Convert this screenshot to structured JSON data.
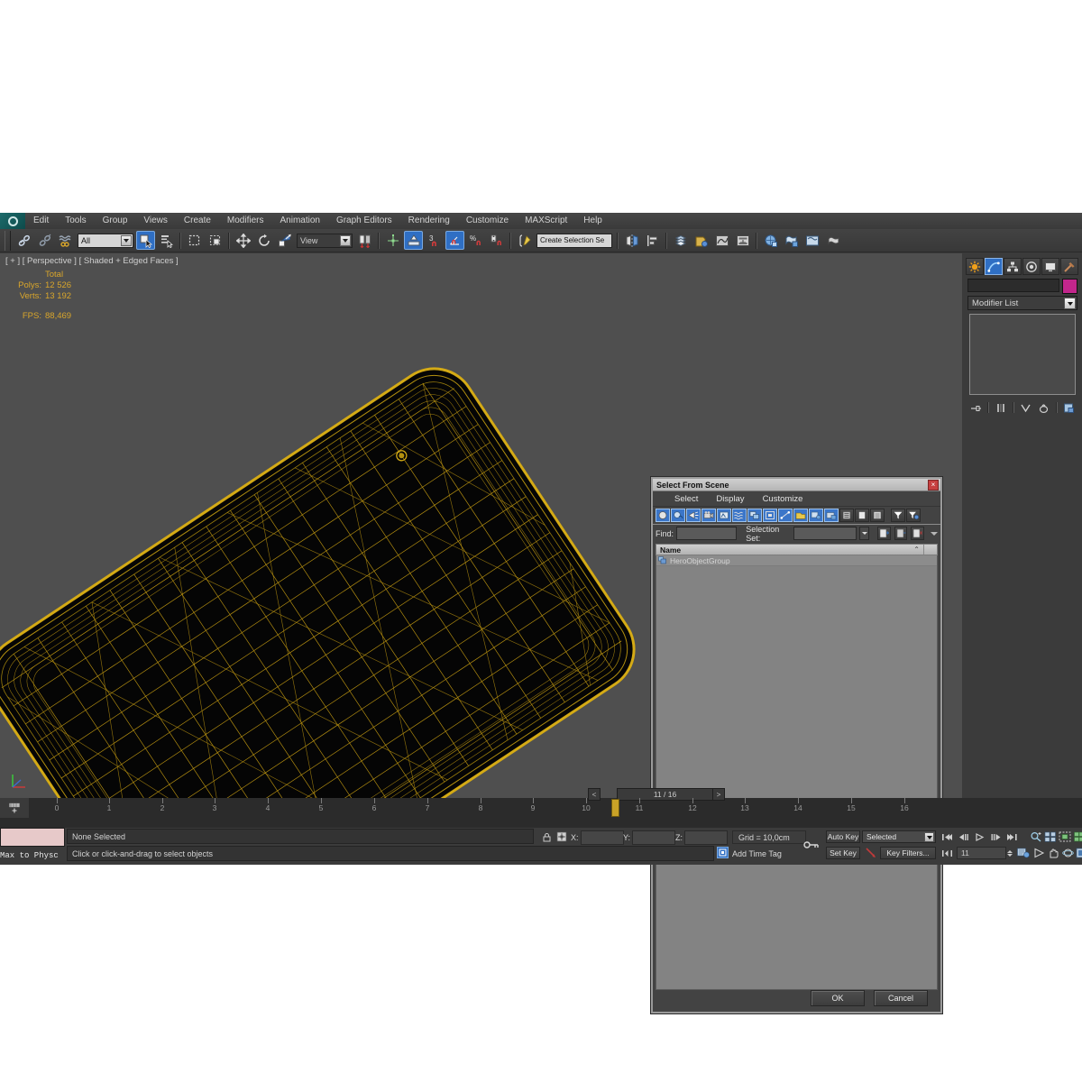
{
  "app": {
    "name": "3ds Max",
    "logo_icon": "max-logo-icon"
  },
  "menu": {
    "items": [
      "Edit",
      "Tools",
      "Group",
      "Views",
      "Create",
      "Modifiers",
      "Animation",
      "Graph Editors",
      "Rendering",
      "Customize",
      "MAXScript",
      "Help"
    ]
  },
  "toolbar": {
    "selection_filter": "All",
    "reference_coordinate_system": "View",
    "named_selection_set": "Create Selection Se",
    "angle_snap_value": "3",
    "icons": [
      "undo-icon",
      "redo-icon",
      "select-link-icon",
      "unlink-icon",
      "bind-space-warp-icon",
      "select-object-icon",
      "select-by-name-icon",
      "rectangular-selection-region-icon",
      "window-crossing-icon",
      "select-and-move-icon",
      "select-and-rotate-icon",
      "select-and-scale-icon",
      "use-pivot-point-center-icon",
      "select-and-manipulate-icon",
      "snaps-toggle-icon",
      "angle-snap-toggle-icon",
      "percent-snap-toggle-icon",
      "spinner-snap-toggle-icon",
      "edit-named-selection-sets-icon",
      "mirror-icon",
      "align-icon",
      "layer-manager-icon",
      "graphite-modeling-tools-icon",
      "curve-editor-icon",
      "schematic-view-icon",
      "material-editor-icon",
      "render-setup-icon",
      "rendered-frame-window-icon",
      "render-production-icon"
    ]
  },
  "viewport": {
    "label": "[ + ] [ Perspective ] [ Shaded + Edged Faces ]",
    "stats": {
      "column_header": "Total",
      "rows": [
        {
          "label": "Polys:",
          "value": "12 526"
        },
        {
          "label": "Verts:",
          "value": "13 192"
        }
      ],
      "fps_label": "FPS:",
      "fps_value": "88,469"
    },
    "object_wireframe_color": "#d4aa15",
    "background_color": "#4f4f4f",
    "axis_tripod": "axis-tripod-icon"
  },
  "command_panel": {
    "tabs": [
      {
        "name": "create-tab",
        "icon": "create-star-icon",
        "active": false
      },
      {
        "name": "modify-tab",
        "icon": "modify-curve-icon",
        "active": true
      },
      {
        "name": "hierarchy-tab",
        "icon": "hierarchy-icon",
        "active": false
      },
      {
        "name": "motion-tab",
        "icon": "motion-wheel-icon",
        "active": false
      },
      {
        "name": "display-tab",
        "icon": "display-monitor-icon",
        "active": false
      },
      {
        "name": "utilities-tab",
        "icon": "utilities-hammer-icon",
        "active": false
      }
    ],
    "object_name_value": "",
    "object_color": "#c2268c",
    "modifier_list_label": "Modifier List",
    "stack_buttons": [
      "pin-stack-icon",
      "show-end-result-icon",
      "make-unique-icon",
      "remove-modifier-icon",
      "configure-modifier-sets-icon"
    ]
  },
  "dialog": {
    "title": "Select From Scene",
    "close_icon": "close-icon",
    "menu": [
      "Select",
      "Display",
      "Customize"
    ],
    "tool_icons": [
      "display-geometry-icon",
      "display-shapes-icon",
      "display-lights-icon",
      "display-cameras-icon",
      "display-helpers-icon",
      "display-space-warps-icon",
      "display-groups-icon",
      "display-xrefs-icon",
      "display-bones-icon",
      "display-containers-icon",
      "display-all-icon",
      "display-none-icon",
      "display-invert-icon",
      "display-children-icon",
      "display-influences-icon",
      "expand-all-icon",
      "filter-icon",
      "advanced-filter-icon"
    ],
    "find_label": "Find:",
    "find_value": "",
    "selection_set_label": "Selection Set:",
    "selection_set_value": "",
    "list_header": "Name",
    "sort_indicator": "sort-ascending-icon",
    "rows": [
      {
        "icon": "group-icon",
        "name": "HeroObjectGroup"
      }
    ],
    "ok_label": "OK",
    "cancel_label": "Cancel"
  },
  "timeline": {
    "frame_indicator": "11 / 16",
    "prev_arrow": "<",
    "next_arrow": ">",
    "current_frame": 11,
    "ticks": [
      "0",
      "1",
      "2",
      "3",
      "4",
      "5",
      "6",
      "7",
      "8",
      "9",
      "10",
      "11",
      "12",
      "13",
      "14",
      "15",
      "16"
    ],
    "open_minicurve_icon": "open-mini-curve-editor-icon"
  },
  "status_bar": {
    "max_to_physical_label": "Max to Physc",
    "selection_status": "None Selected",
    "prompt": "Click or click-and-drag to select objects",
    "lock_icon": "selection-lock-icon",
    "absolute_mode_icon": "absolute-relative-transform-icon",
    "coords": [
      {
        "label": "X:",
        "value": ""
      },
      {
        "label": "Y:",
        "value": ""
      },
      {
        "label": "Z:",
        "value": ""
      }
    ],
    "grid_label": "Grid = 10,0cm",
    "add_time_tag_label": "Add Time Tag",
    "add_time_tag_icon": "time-tag-icon",
    "key_mode_icon": "key-mode-toggle-icon"
  },
  "animation_controls": {
    "auto_key_label": "Auto Key",
    "set_key_label": "Set Key",
    "filter_value": "Selected",
    "key_filters_label": "Key Filters...",
    "set_key_arrow_icon": "set-key-arrow-icon",
    "frame_field_value": "11",
    "playback_icons": [
      "go-to-start-icon",
      "previous-frame-icon",
      "play-animation-icon",
      "next-frame-icon",
      "go-to-end-icon",
      "key-mode-toggle-icon"
    ],
    "viewport_nav_icons": [
      "zoom-icon",
      "zoom-all-icon",
      "zoom-extents-icon",
      "zoom-extents-all-icon",
      "field-of-view-icon",
      "pan-view-icon",
      "orbit-icon",
      "maximize-viewport-toggle-icon"
    ]
  }
}
